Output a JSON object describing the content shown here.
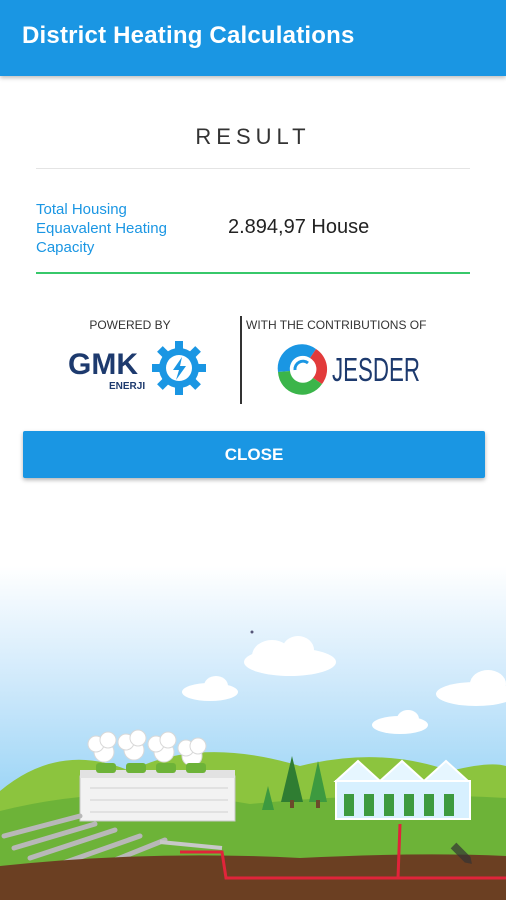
{
  "appbar": {
    "title": "District Heating Calculations"
  },
  "result": {
    "title": "RESULT",
    "label": "Total Housing Equavalent Heating Capacity",
    "value": "2.894,97 House"
  },
  "sponsors": {
    "powered_by": "POWERED BY",
    "gmk_logo_text": "GMK",
    "gmk_logo_sub": "ENERJI",
    "contributions": "WITH THE CONTRIBUTIONS OF",
    "jesder_logo_text": "JESDER"
  },
  "actions": {
    "close_label": "CLOSE"
  },
  "colors": {
    "primary": "#1a96e3",
    "accent_line": "#37c86a",
    "logo_navy": "#1d3a6e"
  }
}
